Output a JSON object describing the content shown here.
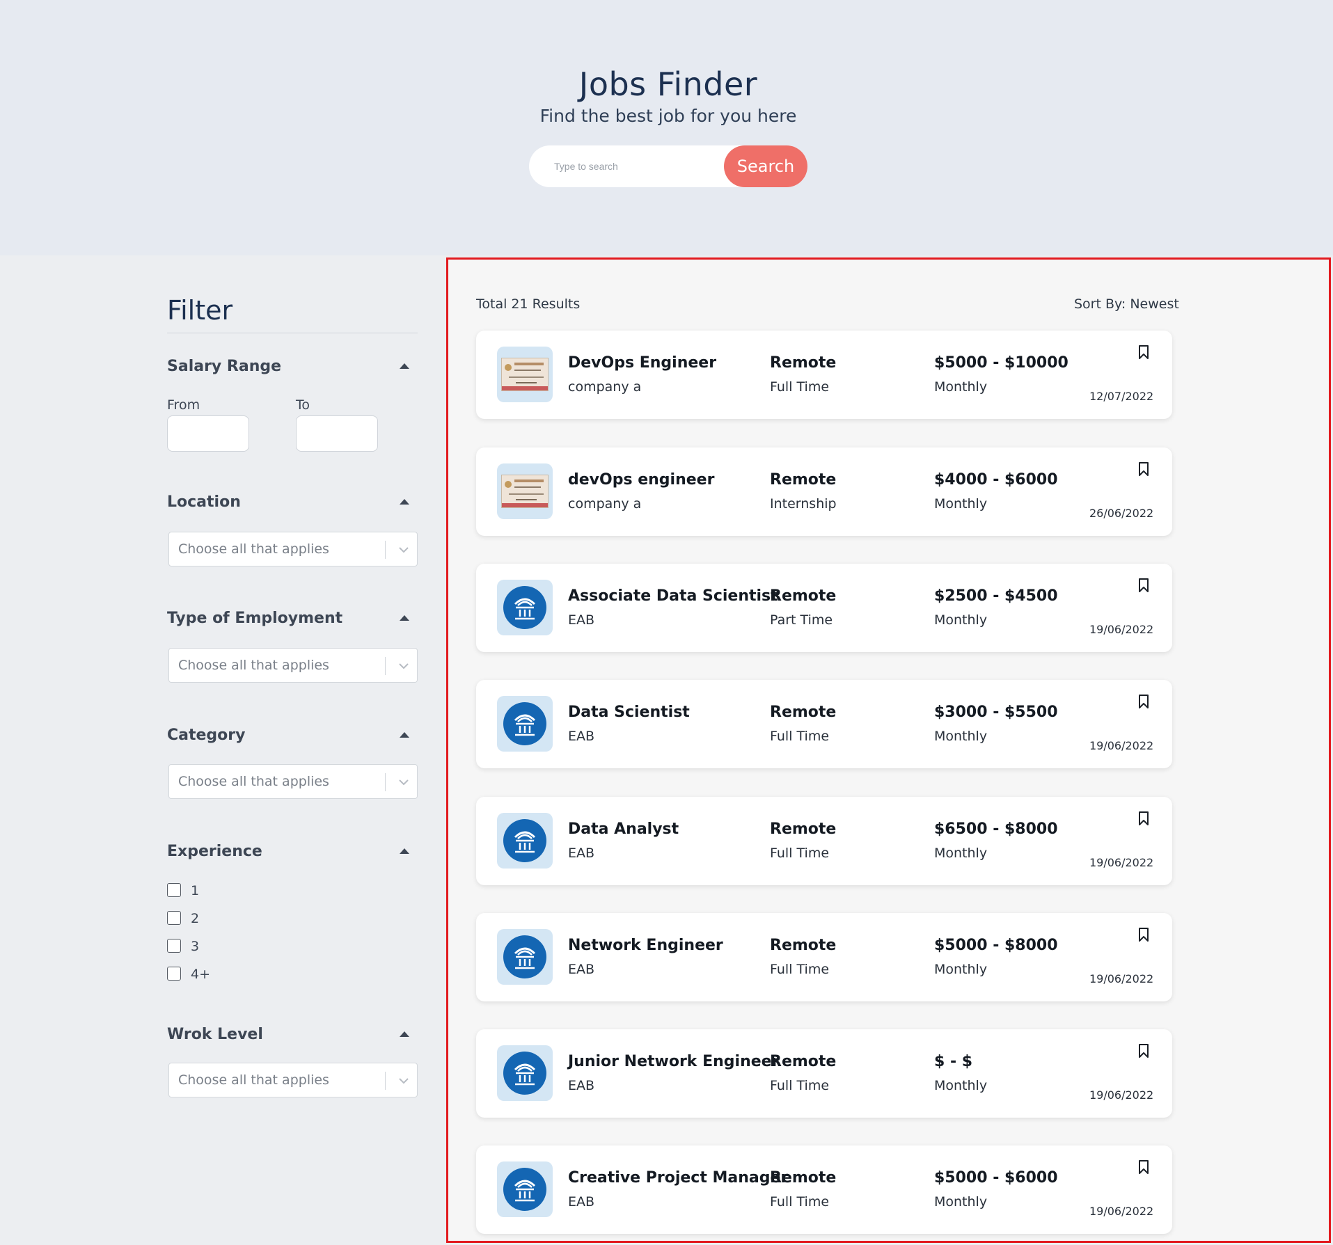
{
  "header": {
    "title": "Jobs Finder",
    "subtitle": "Find the best job for you here",
    "search_placeholder": "Type to search",
    "search_button": "Search"
  },
  "filter": {
    "title": "Filter",
    "salary_range": {
      "label": "Salary Range",
      "from_label": "From",
      "to_label": "To",
      "from_value": "",
      "to_value": ""
    },
    "location": {
      "label": "Location",
      "placeholder": "Choose all that applies"
    },
    "employment": {
      "label": "Type of Employment",
      "placeholder": "Choose all that applies"
    },
    "category": {
      "label": "Category",
      "placeholder": "Choose all that applies"
    },
    "experience": {
      "label": "Experience",
      "options": [
        "1",
        "2",
        "3",
        "4+"
      ]
    },
    "work_level": {
      "label": "Wrok Level",
      "placeholder": "Choose all that applies"
    }
  },
  "results": {
    "total": "Total 21 Results",
    "sort": "Sort By: Newest",
    "jobs": [
      {
        "logo": "certificate-logo",
        "title": "DevOps Engineer",
        "company": "company a",
        "location": "Remote",
        "type": "Full Time",
        "salary": "$5000 - $10000",
        "period": "Monthly",
        "date": "12/07/2022"
      },
      {
        "logo": "certificate-logo",
        "title": "devOps engineer",
        "company": "company a",
        "location": "Remote",
        "type": "Internship",
        "salary": "$4000 - $6000",
        "period": "Monthly",
        "date": "26/06/2022"
      },
      {
        "logo": "eab-logo",
        "title": "Associate Data Scientist",
        "company": "EAB",
        "location": "Remote",
        "type": "Part Time",
        "salary": "$2500 - $4500",
        "period": "Monthly",
        "date": "19/06/2022"
      },
      {
        "logo": "eab-logo",
        "title": "Data Scientist",
        "company": "EAB",
        "location": "Remote",
        "type": "Full Time",
        "salary": "$3000 - $5500",
        "period": "Monthly",
        "date": "19/06/2022"
      },
      {
        "logo": "eab-logo",
        "title": "Data Analyst",
        "company": "EAB",
        "location": "Remote",
        "type": "Full Time",
        "salary": "$6500 - $8000",
        "period": "Monthly",
        "date": "19/06/2022"
      },
      {
        "logo": "eab-logo",
        "title": "Network Engineer",
        "company": "EAB",
        "location": "Remote",
        "type": "Full Time",
        "salary": "$5000 - $8000",
        "period": "Monthly",
        "date": "19/06/2022"
      },
      {
        "logo": "eab-logo",
        "title": "Junior Network Engineer",
        "company": "EAB",
        "location": "Remote",
        "type": "Full Time",
        "salary": "$ - $",
        "period": "Monthly",
        "date": "19/06/2022"
      },
      {
        "logo": "eab-logo",
        "title": "Creative Project Manager",
        "company": "EAB",
        "location": "Remote",
        "type": "Full Time",
        "salary": "$5000 - $6000",
        "period": "Monthly",
        "date": "19/06/2022"
      }
    ]
  },
  "colors": {
    "accent": "#ef6f68",
    "highlight_border": "#e21a1f",
    "eab_blue": "#1466b3",
    "navy": "#1c3050"
  }
}
